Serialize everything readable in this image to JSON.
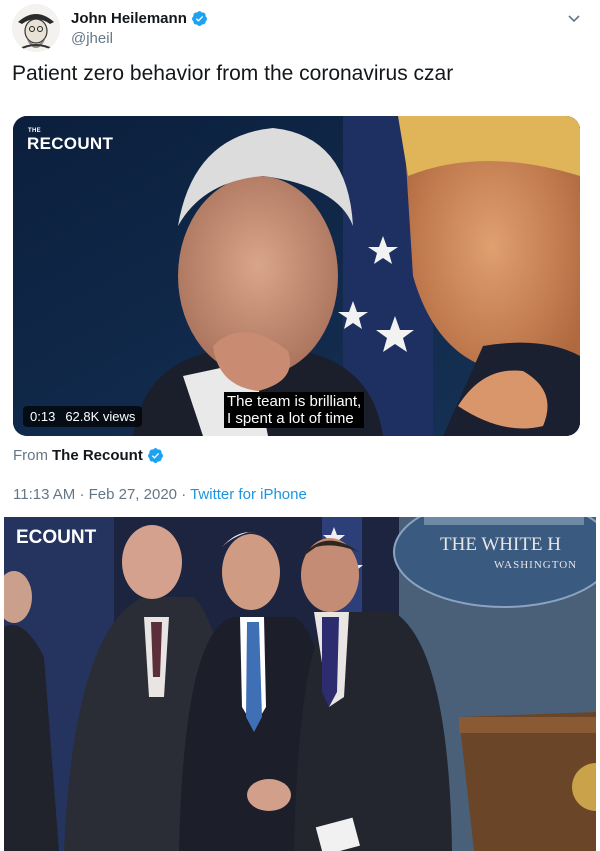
{
  "author": {
    "name": "John Heilemann",
    "handle": "@jheil",
    "verified": true
  },
  "tweet": {
    "text": "Patient zero behavior from the coronavirus czar"
  },
  "video": {
    "logo": "RECOUNT",
    "logo_prefix": "THE",
    "caption": "The team is brilliant,\nI spent a lot of time",
    "duration": "0:13",
    "views": "62.8K views"
  },
  "source": {
    "prefix": "From",
    "name": "The Recount",
    "verified": true
  },
  "meta": {
    "time": "11:13 AM",
    "separator": "·",
    "date": "Feb 27, 2020",
    "app": "Twitter for iPhone"
  },
  "photo": {
    "logo": "ECOUNT",
    "seal_line1": "THE WHITE H",
    "seal_line2": "WASHINGTON"
  },
  "colors": {
    "verified_blue": "#1da1f2",
    "link_blue": "#1b95e0",
    "muted": "#657786"
  },
  "icons": [
    "verified-badge-icon",
    "chevron-down-icon"
  ]
}
